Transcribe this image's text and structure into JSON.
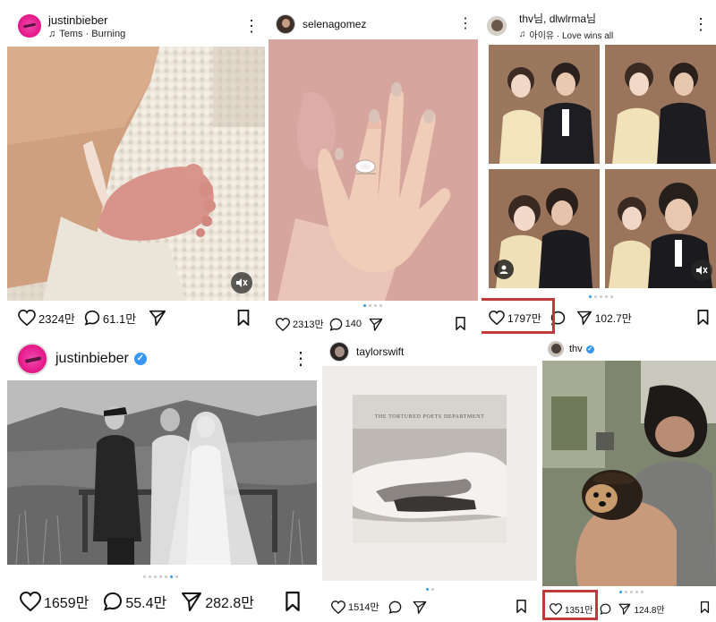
{
  "colors": {
    "highlight": "#c0393b",
    "verified": "#3897f0",
    "dot_active": "#3897f0"
  },
  "posts": [
    {
      "username": "justinbieber",
      "music": "Tems · Burning",
      "media": "photo-baby-foot-on-blanket",
      "likes": "2324만",
      "comments": "61.1만",
      "shares": ""
    },
    {
      "username": "selenagomez",
      "music": "",
      "media": "photo-engagement-ring-hand",
      "likes": "2313만",
      "comments": "140",
      "shares": ""
    },
    {
      "username": "thv님, dlwlrma님",
      "music": "아이유 · Love wins all",
      "media": "photo-grid-couple-photobooth",
      "likes": "1797만",
      "comments": "",
      "shares": "102.7만"
    },
    {
      "username": "justinbieber",
      "music": "",
      "media": "photo-bw-wedding-ceremony",
      "likes": "1659만",
      "comments": "55.4만",
      "shares": "282.8만"
    },
    {
      "username": "taylorswift",
      "music": "",
      "media": "album-the-tortured-poets-department",
      "album_title": "THE TORTURED POETS DEPARTMENT",
      "likes": "1514만",
      "comments": "",
      "shares": ""
    },
    {
      "username": "thv",
      "music": "",
      "media": "photo-man-hugging-dog",
      "likes": "1351만",
      "comments": "",
      "shares": "124.8만"
    }
  ]
}
